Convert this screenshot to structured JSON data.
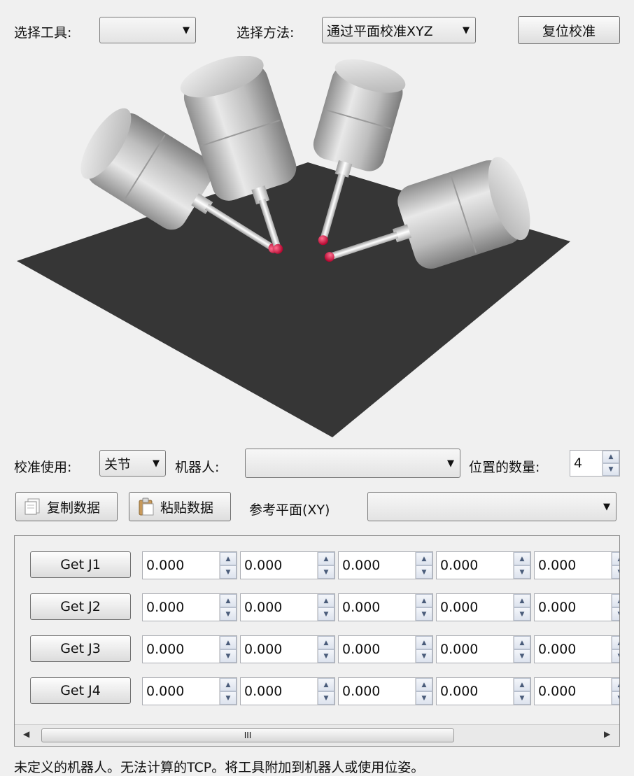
{
  "top": {
    "select_tool_label": "选择工具:",
    "select_tool_value": "",
    "select_method_label": "选择方法:",
    "select_method_value": "通过平面校准XYZ",
    "reset_button": "复位校准"
  },
  "settings": {
    "calib_using_label": "校准使用:",
    "calib_using_value": "关节",
    "robot_label": "机器人:",
    "robot_value": "",
    "num_positions_label": "位置的数量:",
    "num_positions_value": "4",
    "copy_button": "复制数据",
    "paste_button": "粘贴数据",
    "ref_plane_label": "参考平面(XY)",
    "ref_plane_value": ""
  },
  "rows": [
    {
      "button": "Get J1",
      "values": [
        "0.000",
        "0.000",
        "0.000",
        "0.000",
        "0.000"
      ]
    },
    {
      "button": "Get J2",
      "values": [
        "0.000",
        "0.000",
        "0.000",
        "0.000",
        "0.000"
      ]
    },
    {
      "button": "Get J3",
      "values": [
        "0.000",
        "0.000",
        "0.000",
        "0.000",
        "0.000"
      ]
    },
    {
      "button": "Get J4",
      "values": [
        "0.000",
        "0.000",
        "0.000",
        "0.000",
        "0.000"
      ]
    }
  ],
  "scrollbar_thumb_glyph": "III",
  "status": "未定义的机器人。无法计算的TCP。将工具附加到机器人或使用位姿。",
  "colors": {
    "plane": "#333333",
    "probe_body": "#c8c8c8",
    "probe_tip": "#d0103a"
  }
}
